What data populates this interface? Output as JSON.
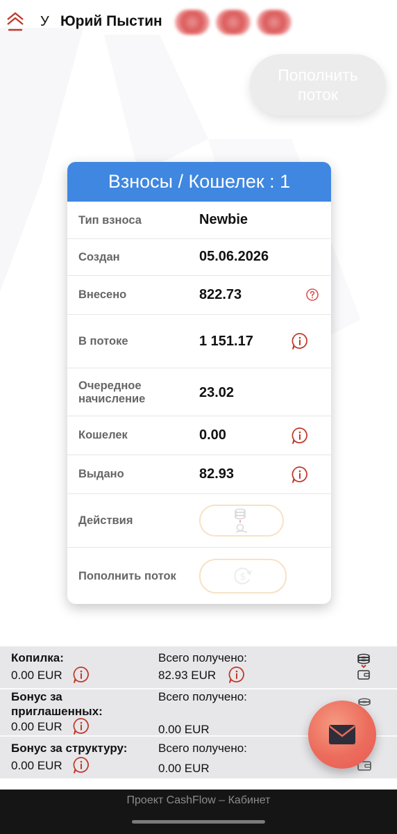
{
  "header": {
    "greeting_prefix": "У",
    "user_name": "Юрий Пыстин",
    "topup_label": "Пополнить поток"
  },
  "card": {
    "title": "Взносы / Кошелек : 1",
    "rows": [
      {
        "label": "Тип взноса",
        "value": "Newbie"
      },
      {
        "label": "Создан",
        "value": "05.06.2026"
      },
      {
        "label": "Внесено",
        "value": "822.73"
      },
      {
        "label": "В потоке",
        "value": "1 151.17"
      },
      {
        "label": "Очередное начисление",
        "value": "23.02"
      },
      {
        "label": "Кошелек",
        "value": "0.00"
      },
      {
        "label": "Выдано",
        "value": "82.93"
      },
      {
        "label": "Действия",
        "value": ""
      },
      {
        "label": "Пополнить поток",
        "value": ""
      }
    ]
  },
  "stats": {
    "piggy": {
      "label": "Копилка:",
      "value": "0.00 EUR",
      "received_label": "Всего получено:",
      "received_value": "82.93 EUR"
    },
    "invite_bonus": {
      "label": "Бонус за приглашенных:",
      "value": "0.00 EUR",
      "received_label": "Всего получено:",
      "received_value": "0.00 EUR"
    },
    "structure_bonus": {
      "label": "Бонус за структуру:",
      "value": "0.00 EUR",
      "received_label": "Всего получено:",
      "received_value": "0.00 EUR"
    }
  },
  "footer": {
    "text": "Проект CashFlow – Кабинет"
  },
  "icons": {
    "home": "home-chevrons-icon",
    "info": "info-bubble-icon",
    "help": "question-circle-icon",
    "coins": "coins-stack-icon",
    "wallet": "wallet-icon",
    "mail": "mail-icon"
  },
  "colors": {
    "card_header": "#3f87e0",
    "accent_red": "#c0392b",
    "fab": "#ec6c5c",
    "footer_bg": "#151515"
  }
}
